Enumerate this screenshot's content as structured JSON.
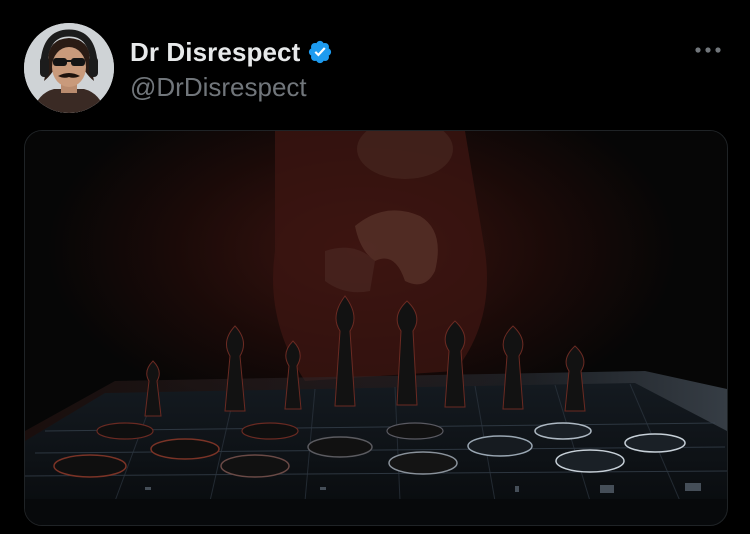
{
  "post": {
    "author": {
      "display_name": "Dr Disrespect",
      "handle": "@DrDisrespect",
      "verified": true,
      "avatar_icon": "profile-photo"
    },
    "more_icon": "more-horizontal-icon",
    "verified_icon": "verified-badge-icon",
    "media": {
      "kind": "photo",
      "subject": "chess-board-photo"
    }
  },
  "colors": {
    "background": "#000000",
    "name_text": "#e7e9ea",
    "secondary_text": "#71767b",
    "verified_blue": "#1d9bf0",
    "media_border": "#1f2326"
  }
}
